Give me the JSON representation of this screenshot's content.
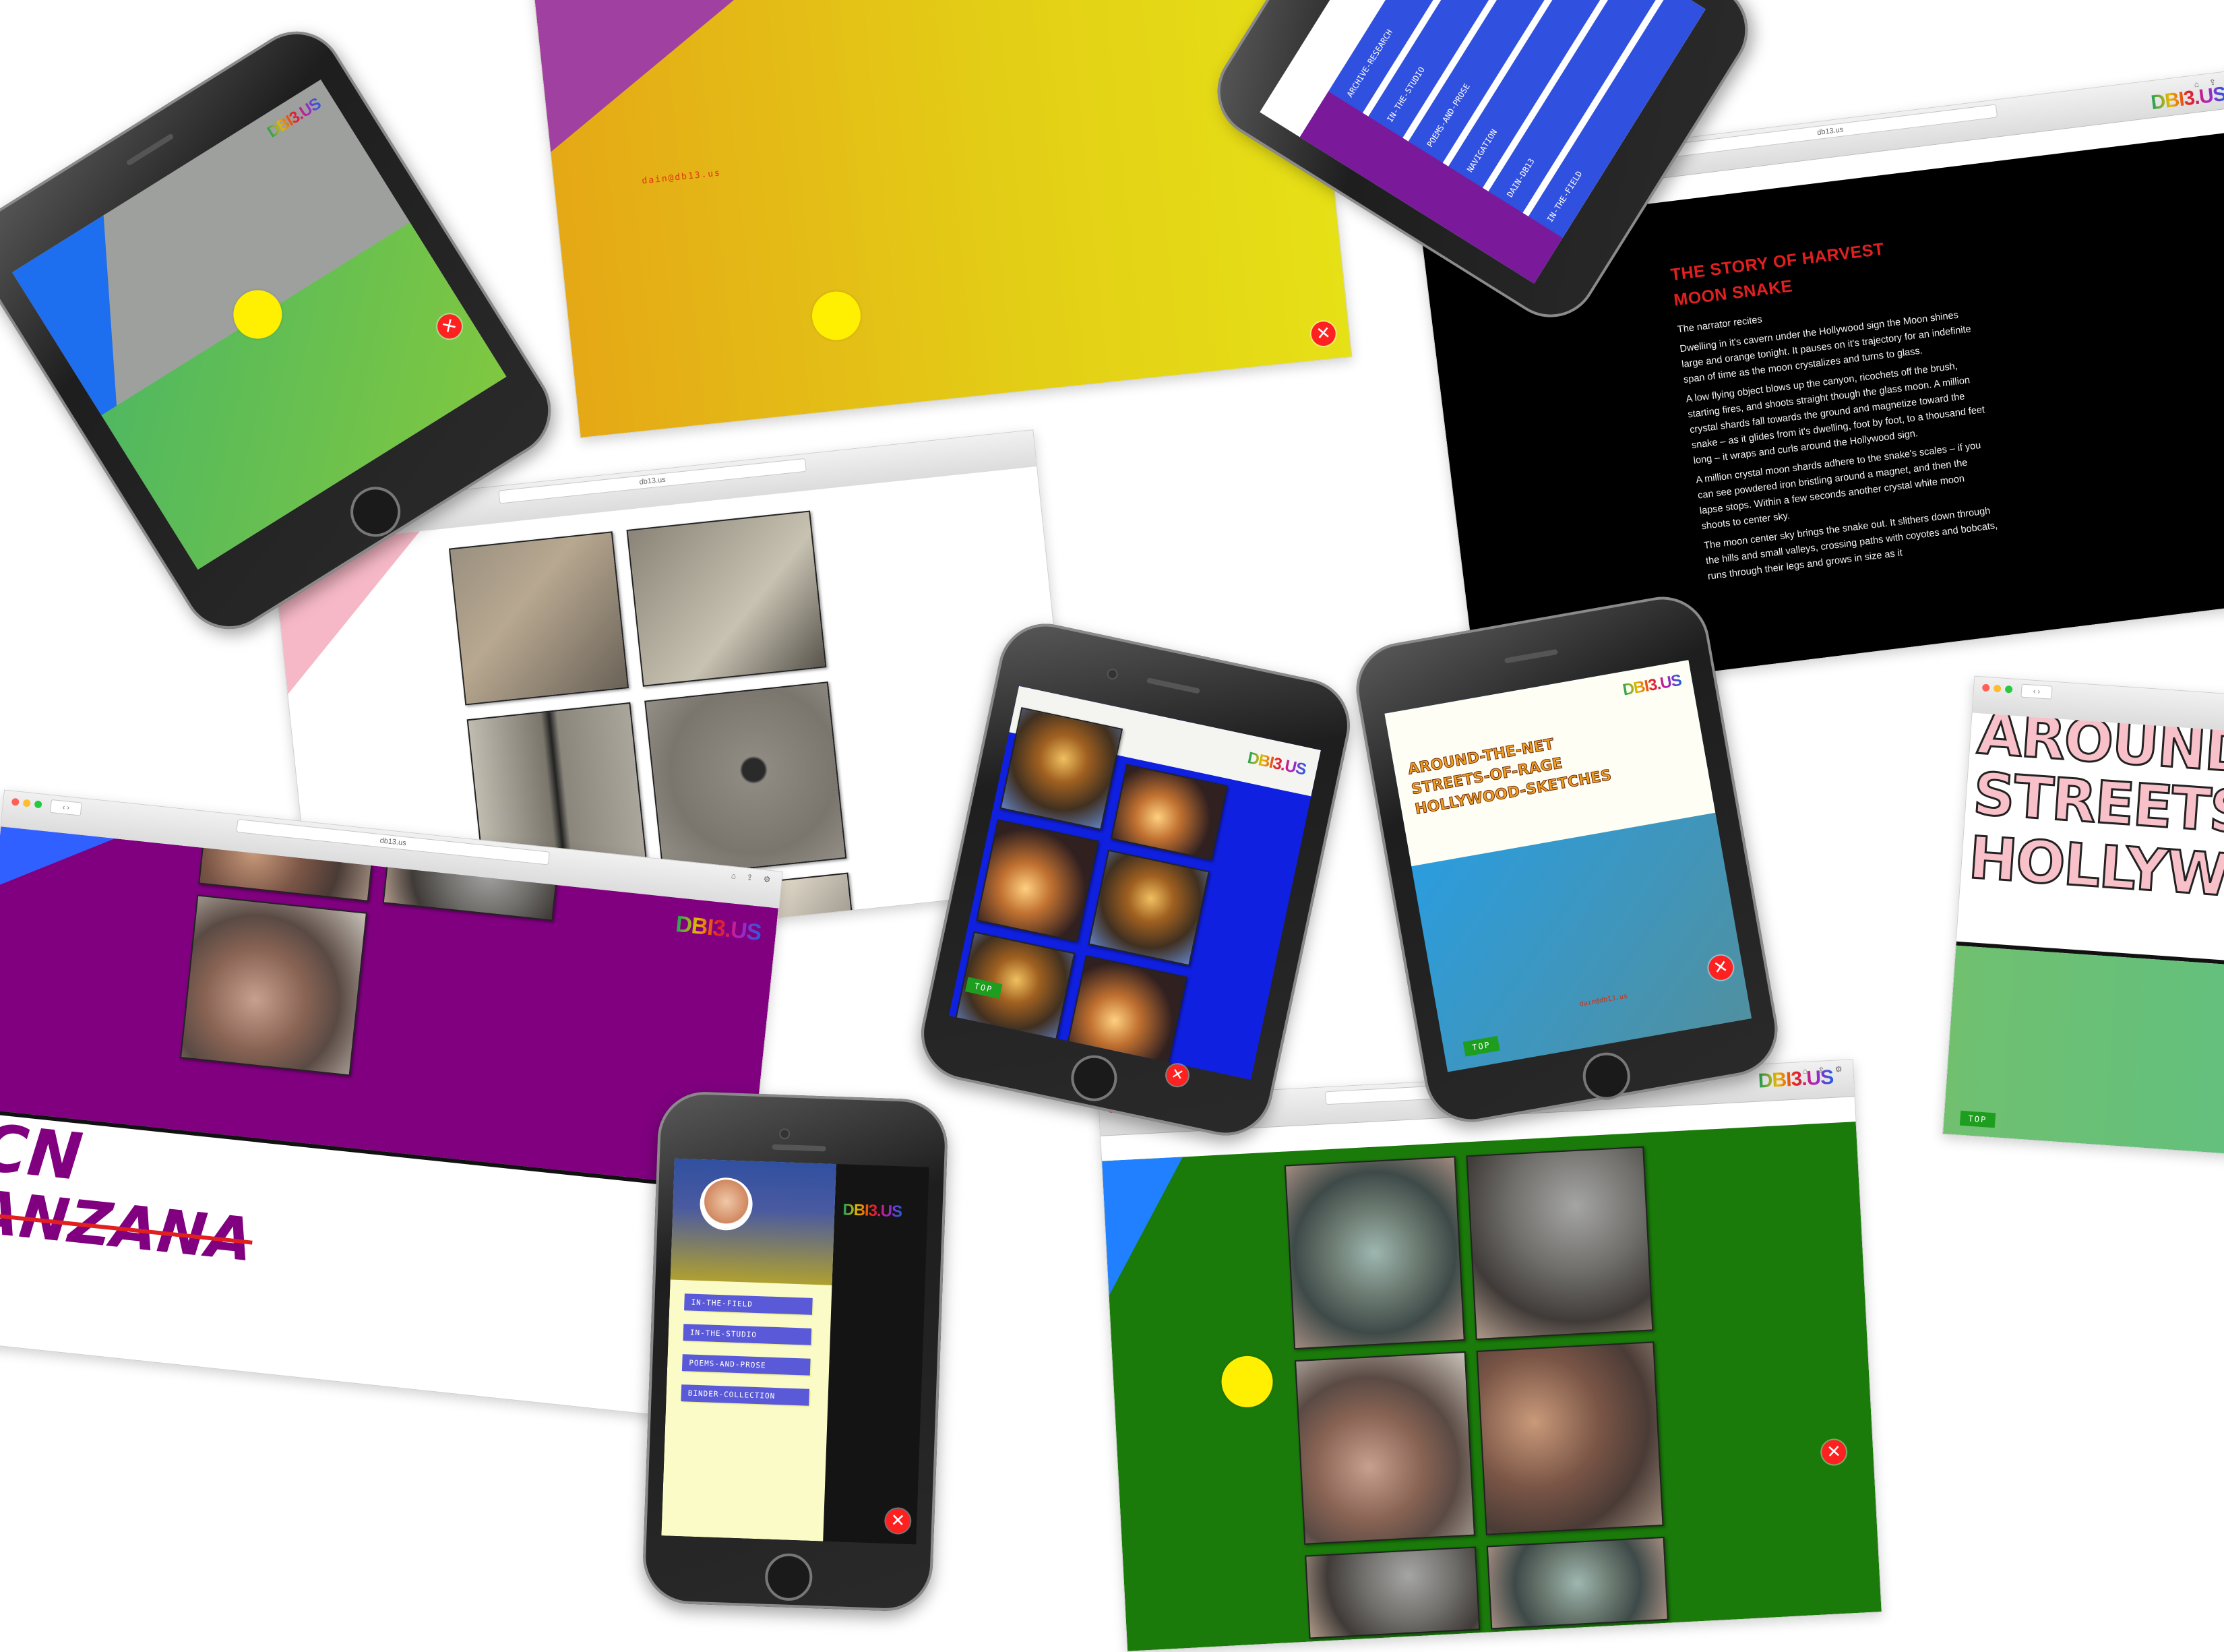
{
  "site": {
    "logo_text": "DBI3.US",
    "url": "db13.us",
    "email": "dain@db13.us",
    "top_label": "TOP",
    "close_glyph": "✕"
  },
  "colors": {
    "yellow_sun": "#ffef00",
    "close_red": "#ff2020",
    "purple": "#800080",
    "green": "#1a7a0a",
    "story_title": "#e02020"
  },
  "story": {
    "title": "THE STORY OF HARVEST MOON SNAKE",
    "paragraphs": [
      "The narrator recites",
      "Dwelling in it's cavern under the Hollywood sign the Moon shines large and orange tonight. It pauses on it's trajectory for an indefinite span of time as the moon crystalizes and turns to glass.",
      "A low flying object blows up the canyon, ricochets off the brush, starting fires, and shoots straight though the glass moon. A million crystal shards fall towards the ground and magnetize toward the snake – as it glides from it's dwelling, foot by foot, to a thousand feet long – it wraps and curls around the Hollywood sign.",
      "A million crystal moon shards adhere to the snake's scales – if you can see powdered iron bristling around a magnet, and then the lapse stops. Within a few seconds another crystal white moon shoots to center sky.",
      "The moon center sky brings the snake out. It slithers down through the hills and small valleys, crossing paths with coyotes and bobcats, runs through their legs and grows in size as it"
    ]
  },
  "streets": {
    "lines": [
      "AROUND-THE-NET",
      "STREETS-OF-RAGE",
      "HOLLYWOOD-SKETCHES"
    ],
    "crop_lines": [
      "AROUND",
      "STREETS-",
      "HOLLYWO"
    ]
  },
  "purple_page": {
    "line1": "CN",
    "line2": "ANZANA"
  },
  "menu": {
    "items": [
      "IN-THE-FIELD",
      "IN-THE-STUDIO",
      "POEMS-AND-PROSE",
      "BINDER-COLLECTION"
    ]
  },
  "vertical_nav": {
    "items": [
      "ARCHIVE-RESEARCH",
      "IN-THE-STUDIO",
      "POEMS-AND-PROSE",
      "NAVIGATION",
      "DAIN-DB13",
      "IN-THE-FIELD"
    ]
  }
}
